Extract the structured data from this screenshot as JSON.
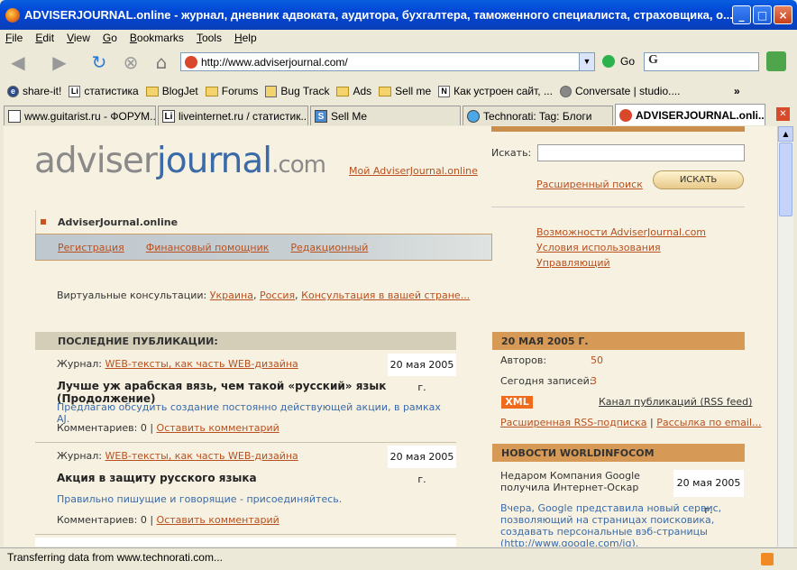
{
  "window": {
    "title": "ADVISERJOURNAL.online - журнал, дневник адвоката, аудитора, бухгалтера, таможенного специалиста, страховщика, о...",
    "min": "_",
    "max": "□",
    "close": "×"
  },
  "menu": [
    "File",
    "Edit",
    "View",
    "Go",
    "Bookmarks",
    "Tools",
    "Help"
  ],
  "nav": {
    "url": "http://www.adviserjournal.com/",
    "go_label": "Go",
    "search_value": "G"
  },
  "bookmarks": [
    {
      "label": "share-it!",
      "icon": "e5"
    },
    {
      "label": "статистика",
      "icon": "Li"
    },
    {
      "label": "BlogJet",
      "icon": "folder"
    },
    {
      "label": "Forums",
      "icon": "folder"
    },
    {
      "label": "Bug Track",
      "icon": "bug"
    },
    {
      "label": "Ads",
      "icon": "folder"
    },
    {
      "label": "Sell me",
      "icon": "folder"
    },
    {
      "label": "Как устроен сайт, ...",
      "icon": "N"
    },
    {
      "label": "Conversate | studio....",
      "icon": "bubble"
    }
  ],
  "tabs": [
    {
      "label": "www.guitarist.ru - ФОРУМ...",
      "icon": "page"
    },
    {
      "label": "liveinternet.ru / статистик...",
      "icon": "Li"
    },
    {
      "label": "Sell Me",
      "icon": "SM"
    },
    {
      "label": "Technorati: Tag: Блоги",
      "icon": "bubble"
    },
    {
      "label": "ADVISERJOURNAL.onli...",
      "icon": "site"
    }
  ],
  "status": "Transferring data from www.technorati.com...",
  "site": {
    "logo_a": "adviser",
    "logo_b": "journal",
    "logo_c": ".com",
    "my_link": "Мой AdviserJournal.online",
    "search_label": "Искать:",
    "search_value": "",
    "advanced_search": "Расширенный поиск",
    "search_button": "ИСКАТЬ",
    "section_title": "AdviserJournal.online",
    "section_nav": [
      "Регистрация",
      "Финансовый помощник",
      "Редакционный "
    ],
    "right_links": [
      "Возможности AdviserJournal.com",
      "Условия использования",
      "Управляющий"
    ],
    "virtual_label": "Виртуальные консультации:",
    "virtual_links": [
      "Украина",
      "Россия",
      "Консультация в вашей стране..."
    ],
    "latest_head": "ПОСЛЕДНИЕ ПУБЛИКАЦИИ:",
    "journal_label": "Журнал:",
    "comments_label": "Комментариев: 0",
    "leave_comment": "Оставить комментарий",
    "publications": [
      {
        "journal": "WEB-тексты, как часть WEB-дизайна",
        "date": "20 мая 2005 г.",
        "title": "Лучше уж арабская вязь, чем такой «русский» язык (Продолжение)",
        "desc": "Предлагаю обсудить создание постоянно действующей акции, в рамках AJ."
      },
      {
        "journal": "WEB-тексты, как часть WEB-дизайна",
        "date": "20 мая 2005 г.",
        "title": "Акция в защиту русского языка",
        "desc": "Правильно пишущие и говорящие - присоединяйтесь."
      }
    ],
    "stats_head": "20 МАЯ 2005 Г.",
    "authors_label": "Авторов:",
    "authors_value": "50",
    "today_label": "Сегодня записей:",
    "today_value": "3",
    "xml_label": "XML",
    "rss_channel": "Канал публикаций (RSS feed)",
    "rss_ext": "Расширенная RSS-подписка",
    "email_sub": "Рассылка по email...",
    "news_head": "НОВОСТИ WORLDINFOCOM",
    "news_title": "Недаром Компания Google получила Интернет-Оскар",
    "news_date": "20 мая 2005 г.",
    "news_text": "Вчера, Google представила новый сервис, позволяющий на страницах поисковика, создавать персональные вэб-страницы (http://www.google.com/ig)."
  },
  "colors": {
    "accent": "#c98e4b",
    "link": "#b8501f",
    "blue": "#3a6aa8",
    "page_bg": "#f7f1e1"
  }
}
